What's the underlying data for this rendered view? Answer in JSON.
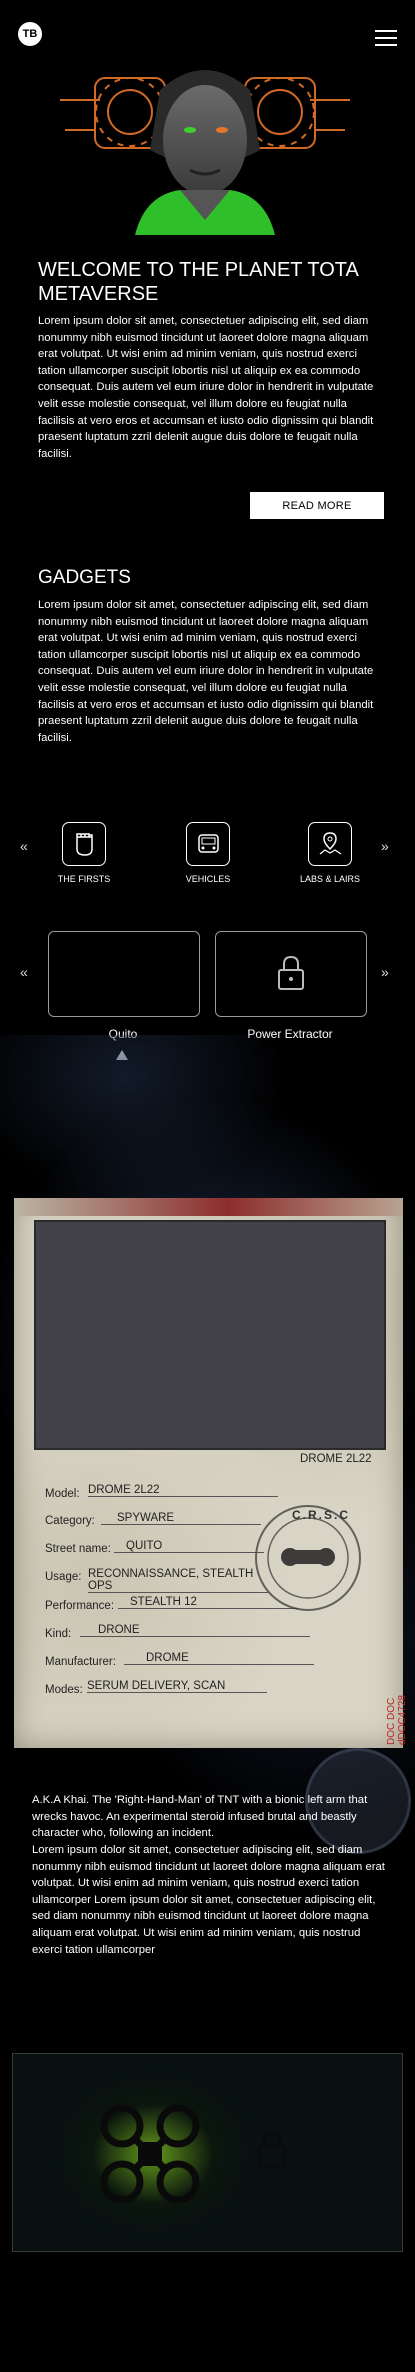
{
  "header": {
    "logo_text": "TB",
    "menu_icon": "hamburger-icon"
  },
  "hero": {
    "title": "WELCOME TO THE PLANET TOTA METAVERSE",
    "body": "Lorem ipsum dolor sit amet, consectetuer adipiscing elit, sed diam nonummy nibh euismod tincidunt ut laoreet dolore magna aliquam erat volutpat. Ut wisi enim ad minim veniam, quis nostrud exerci tation ullamcorper suscipit lobortis nisl ut aliquip ex ea commodo consequat. Duis autem vel eum iriure dolor in hendrerit in vulputate velit esse molestie consequat, vel illum dolore eu feugiat nulla facilisis at vero eros et accumsan et iusto odio dignissim qui blandit praesent luptatum zzril delenit augue duis dolore te feugait nulla facilisi.",
    "button": "READ MORE"
  },
  "gadgets": {
    "title": "GADGETS",
    "body": "Lorem ipsum dolor sit amet, consectetuer adipiscing elit, sed diam nonummy nibh euismod tincidunt ut laoreet dolore magna aliquam erat volutpat. Ut wisi enim ad minim veniam, quis nostrud exerci tation ullamcorper suscipit lobortis nisl ut aliquip ex ea commodo consequat. Duis autem vel eum iriure dolor in hendrerit in vulputate velit esse molestie consequat, vel illum dolore eu feugiat nulla facilisis at vero eros et accumsan et iusto odio dignissim qui blandit praesent luptatum zzril delenit augue duis dolore te feugait nulla facilisi."
  },
  "categories": [
    {
      "label": "THE FIRSTS",
      "icon": "fist-icon"
    },
    {
      "label": "VEHICLES",
      "icon": "vehicle-icon"
    },
    {
      "label": "LABS & LAIRS",
      "icon": "location-pins-icon"
    }
  ],
  "gadget_cards": [
    {
      "label": "Quito",
      "locked": false,
      "selected": true
    },
    {
      "label": "Power Extractor",
      "locked": true,
      "selected": false
    }
  ],
  "dossier": {
    "screen_label": "DROME 2L22",
    "fields": [
      {
        "key": "Model:",
        "value": "DROME 2L22"
      },
      {
        "key": "Category:",
        "value": "SPYWARE"
      },
      {
        "key": "Street name:",
        "value": "QUITO"
      },
      {
        "key": "Usage:",
        "value": "RECONNAISSANCE, STEALTH OPS"
      },
      {
        "key": "Performance:",
        "value": "STEALTH 12"
      },
      {
        "key": "Kind:",
        "value": "DRONE"
      },
      {
        "key": "Manufacturer:",
        "value": "DROME"
      },
      {
        "key": "Modes:",
        "value": "SERUM DELIVERY, SCAN"
      }
    ],
    "stamp_text": "C.R.S.C",
    "doc_number": "DOC DOC dDOC4728"
  },
  "description": {
    "intro": "A.K.A Khai. The 'Right-Hand-Man' of TNT with a bionic left arm that wrecks havoc. An experimental steroid infused brutal and beastly character who, following an incident.",
    "body": "Lorem ipsum dolor sit amet, consectetuer adipiscing elit, sed diam nonummy nibh euismod tincidunt ut laoreet dolore magna aliquam erat volutpat. Ut wisi enim ad minim veniam, quis nostrud exerci tation ullamcorper Lorem ipsum dolor sit amet, consectetuer adipiscing elit, sed diam nonummy nibh euismod tincidunt ut laoreet dolore magna aliquam erat volutpat. Ut wisi enim ad minim veniam, quis nostrud exerci tation ullamcorper"
  },
  "colors": {
    "background": "#000000",
    "accent_green": "#3dd12c",
    "accent_orange": "#e8762a",
    "stamp_red": "#b22222"
  }
}
